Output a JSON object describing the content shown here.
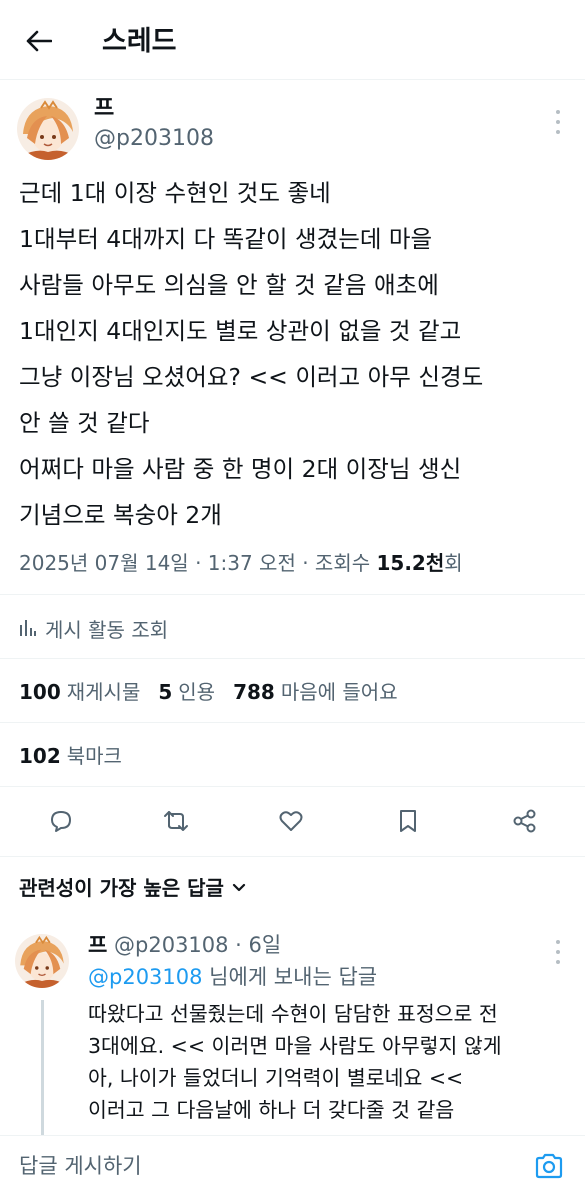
{
  "header": {
    "title": "스레드"
  },
  "tweet": {
    "author_name": "프",
    "author_handle": "@p203108",
    "lines": [
      "근데 1대 이장 수현인 것도 좋네",
      "1대부터 4대까지 다 똑같이 생겼는데 마을",
      "사람들 아무도 의심을 안 할 것 같음 애초에",
      "1대인지 4대인지도 별로 상관이 없을 것 같고",
      "그냥 이장님 오셨어요? << 이러고 아무 신경도",
      "안 쓸 것 같다",
      "어쩌다 마을 사람 중 한 명이 2대 이장님 생신",
      "기념으로 복숭아 2개"
    ],
    "timestamp": "2025년 07월 14일 · 1:37 오전 · 조회수 ",
    "views_count": "15.2천",
    "views_suffix": "회",
    "activity_label": "게시 활동 조회",
    "stats": {
      "reposts_count": "100",
      "reposts_label": "재게시물",
      "quotes_count": "5",
      "quotes_label": "인용",
      "likes_count": "788",
      "likes_label": "마음에 들어요",
      "bookmarks_count": "102",
      "bookmarks_label": "북마크"
    }
  },
  "actions": {
    "icons": [
      "reply-icon",
      "repost-icon",
      "like-icon",
      "bookmark-icon",
      "share-icon"
    ]
  },
  "replies_section": {
    "sort_label": "관련성이 가장 높은 답글"
  },
  "reply": {
    "author_name": "프",
    "author_handle": "@p203108 · 6일",
    "mention": "@p203108",
    "reply_to_suffix": " 님에게 보내는 답글",
    "lines": [
      "따왔다고 선물줬는데 수현이 담담한 표정으로 전",
      "3대에요. << 이러면 마을 사람도 아무렇지 않게",
      "아, 나이가 들었더니 기억력이 별로네요 <<",
      "이러고 그 다음날에 하나 더 갖다줄 것 같음"
    ]
  },
  "composer": {
    "placeholder": "답글 게시하기"
  },
  "colors": {
    "text": "#0f1419",
    "secondary": "#536471",
    "accent": "#1d9bf0",
    "divider": "#eff3f4"
  }
}
